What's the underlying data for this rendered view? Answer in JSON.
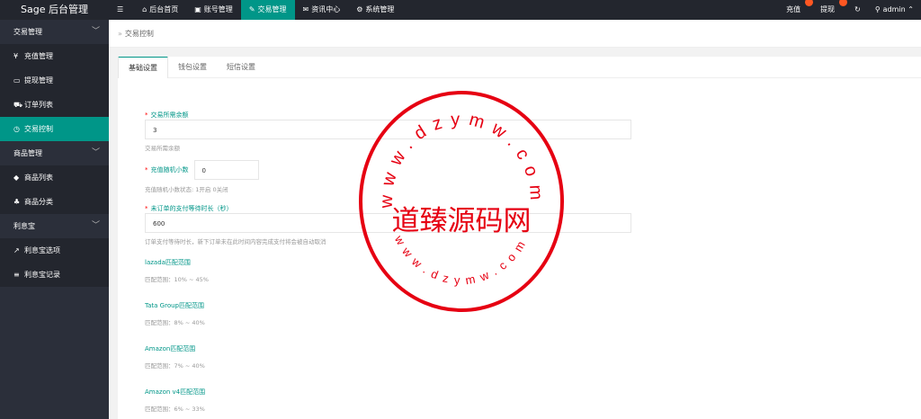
{
  "app": {
    "title": "Sage 后台管理"
  },
  "topnav": {
    "items": [
      {
        "icon": "☰",
        "label": ""
      },
      {
        "icon": "⌂",
        "label": "后台首页"
      },
      {
        "icon": "▣",
        "label": "账号管理"
      },
      {
        "icon": "✎",
        "label": "交易管理"
      },
      {
        "icon": "✉",
        "label": "资讯中心"
      },
      {
        "icon": "⚙",
        "label": "系统管理"
      }
    ]
  },
  "tools": {
    "recharge": "充值",
    "withdraw": "提现",
    "refresh_icon": "↻",
    "user": "admin",
    "user_icon": "⚲"
  },
  "sidebar": {
    "groups": [
      {
        "label": "交易管理",
        "items": [
          {
            "icon": "¥",
            "label": "充值管理"
          },
          {
            "icon": "▭",
            "label": "提现管理"
          },
          {
            "icon": "⛟",
            "label": "订单列表"
          },
          {
            "icon": "◷",
            "label": "交易控制"
          }
        ]
      },
      {
        "label": "商品管理",
        "items": [
          {
            "icon": "◆",
            "label": "商品列表"
          },
          {
            "icon": "♣",
            "label": "商品分类"
          }
        ]
      },
      {
        "label": "利息宝",
        "items": [
          {
            "icon": "↗",
            "label": "利息宝选项"
          },
          {
            "icon": "≡",
            "label": "利息宝记录"
          }
        ]
      }
    ]
  },
  "breadcrumb": {
    "sep": "»",
    "current": "交易控制"
  },
  "tabs": [
    "基础设置",
    "钱包设置",
    "短信设置"
  ],
  "form": {
    "f1": {
      "label": "交易所需余额",
      "value": "3",
      "help": "交易所需余额"
    },
    "f2": {
      "label": "充值随机小数",
      "value": "0",
      "help": "充值随机小数状态: 1开启 0关闭"
    },
    "f3": {
      "label": "未订单的支付等待时长（秒）",
      "value": "600",
      "help": "订单支付等待时长，新下订单未在此时间内容完成支付将会被自动取消"
    },
    "f4": {
      "label": "lazada匹配范围",
      "help": "匹配范围：10% ~ 45%"
    },
    "f5": {
      "label": "Tata Group匹配范围",
      "help": "匹配范围：8% ~ 40%"
    },
    "f6": {
      "label": "Amazon匹配范围",
      "help": "匹配范围：7% ~ 40%"
    },
    "f7": {
      "label": "Amazon v4匹配范围",
      "help": "匹配范围：6% ~ 33%"
    }
  },
  "stamp": {
    "center": "道臻源码网",
    "url": "www.dzymw.com",
    "color": "#e60012"
  }
}
